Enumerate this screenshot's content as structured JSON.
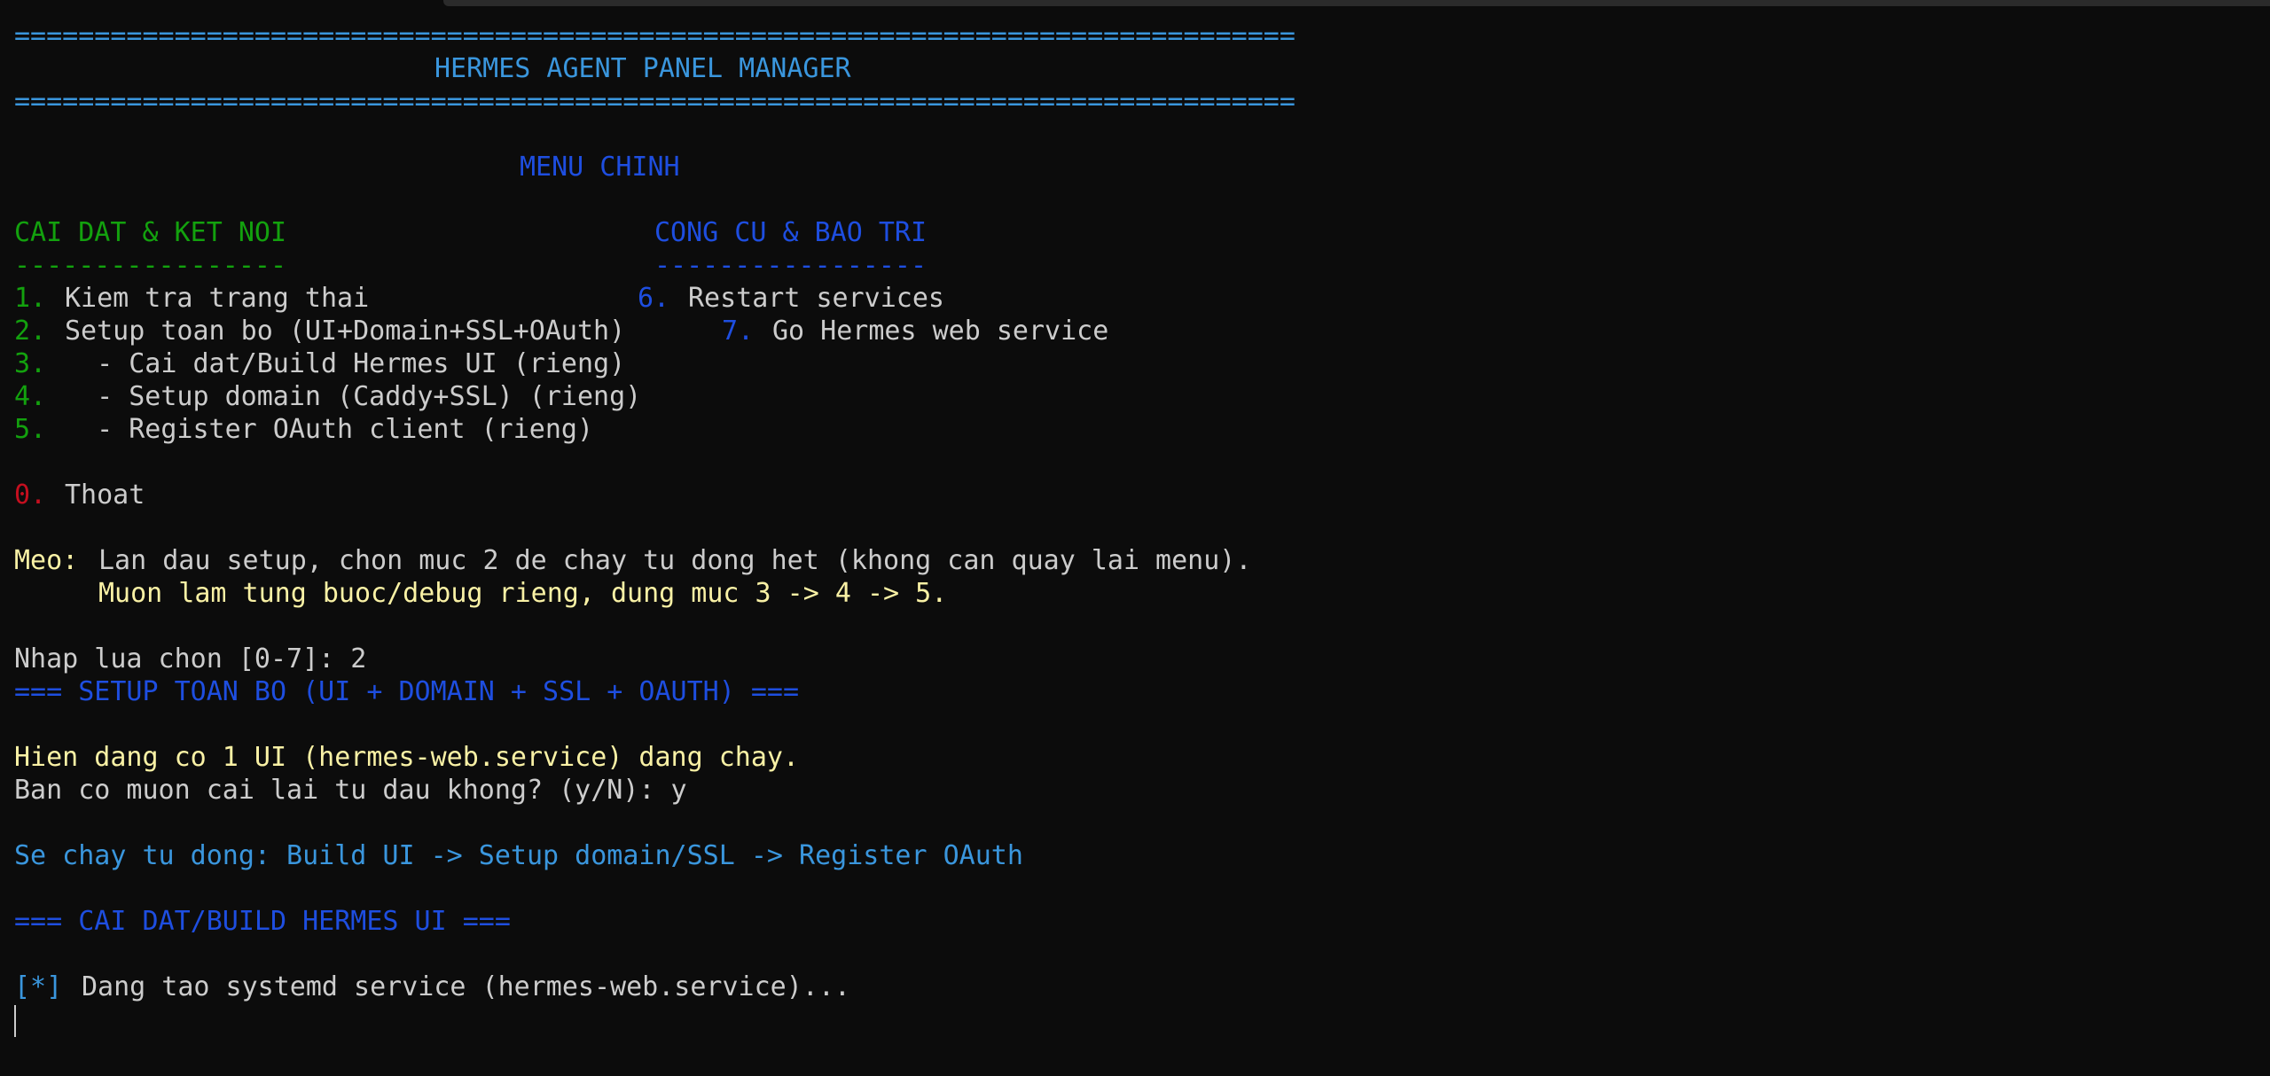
{
  "banner": {
    "rule": "================================================================================",
    "title": "HERMES AGENT PANEL MANAGER"
  },
  "menu": {
    "title": "MENU CHINH",
    "left_section": {
      "heading": "CAI DAT & KET NOI",
      "underline": "-----------------",
      "items": [
        {
          "num": "1.",
          "label": "Kiem tra trang thai"
        },
        {
          "num": "2.",
          "label": "Setup toan bo (UI+Domain+SSL+OAuth)"
        },
        {
          "num": "3.",
          "label": "  - Cai dat/Build Hermes UI (rieng)"
        },
        {
          "num": "4.",
          "label": "  - Setup domain (Caddy+SSL) (rieng)"
        },
        {
          "num": "5.",
          "label": "  - Register OAuth client (rieng)"
        }
      ]
    },
    "right_section": {
      "heading": "CONG CU & BAO TRI",
      "underline": "-----------------",
      "items": [
        {
          "num": "6.",
          "label": "Restart services"
        },
        {
          "num": "7.",
          "label": "Go Hermes web service"
        }
      ]
    },
    "exit": {
      "num": "0.",
      "label": "Thoat"
    }
  },
  "tip": {
    "label": "Meo:",
    "line1": "Lan dau setup, chon muc 2 de chay tu dong het (khong can quay lai menu).",
    "line2": "Muon lam tung buoc/debug rieng, dung muc 3 -> 4 -> 5."
  },
  "session": {
    "prompt": "Nhap lua chon [0-7]: 2",
    "setup_header": "=== SETUP TOAN BO (UI + DOMAIN + SSL + OAUTH) ===",
    "running_notice": "Hien dang co 1 UI (hermes-web.service) dang chay.",
    "reinstall_prompt": "Ban co muon cai lai tu dau khong? (y/N): y",
    "auto_flow": "Se chay tu dong: Build UI -> Setup domain/SSL -> Register OAuth",
    "build_header": "=== CAI DAT/BUILD HERMES UI ===",
    "status_marker": "[*]",
    "status_text": "Dang tao systemd service (hermes-web.service)..."
  },
  "colors": {
    "background": "#0c0c0c",
    "cyan": "#3a96dd",
    "blue": "#1e4ee0",
    "green": "#13a10e",
    "red": "#c50f1f",
    "yellow": "#f9f1a5",
    "text": "#cccccc"
  }
}
